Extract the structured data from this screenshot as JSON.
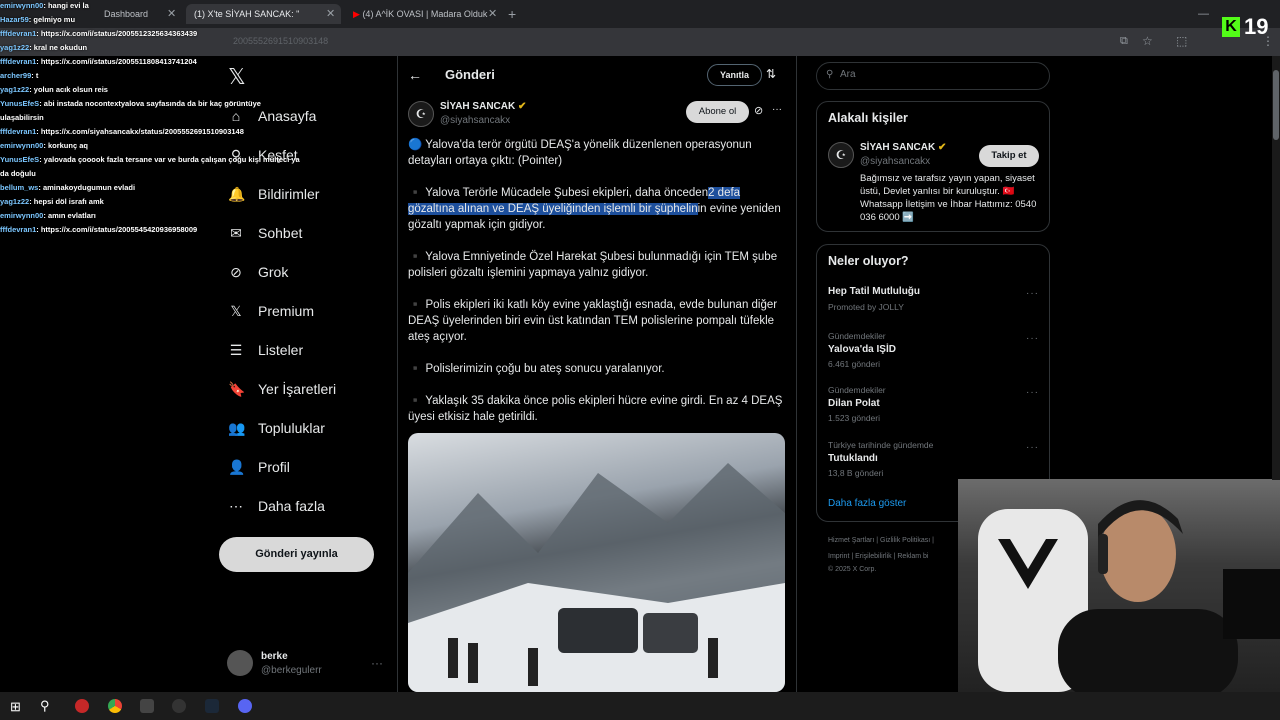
{
  "browser": {
    "tabs": [
      {
        "label": "Dashboard"
      },
      {
        "label": "(1) X'te SİYAH SANCAK: \"",
        "active": true
      },
      {
        "label": "(4) A^İK OVASI | Madara Olduk"
      }
    ],
    "url_fragment": "2005552691510903148"
  },
  "chat": {
    "messages": [
      {
        "user": "emirwynn00",
        "text": ": hangi evi la"
      },
      {
        "user": "Hazar59",
        "text": ": gelmiyo mu"
      },
      {
        "user": "fffdevran1",
        "text": ": https://x.com/i/status/2005512325634363439"
      },
      {
        "user": "yag1z22",
        "text": ": kral ne okudun"
      },
      {
        "user": "fffdevran1",
        "text": ": https://x.com/i/status/2005511808413741204"
      },
      {
        "user": "archer99",
        "text": ": t"
      },
      {
        "user": "yag1z22",
        "text": ": yolun acık olsun reis"
      },
      {
        "user": "YunusEfeS",
        "text": ": abi instada nocontextyalova sayfasında da bir kaç görüntüye"
      },
      {
        "user": "",
        "text": "ulaşabilirsin"
      },
      {
        "user": "fffdevran1",
        "text": ": https://x.com/siyahsancakx/status/2005552691510903148"
      },
      {
        "user": "emirwynn00",
        "text": ": korkunç aq"
      },
      {
        "user": "YunusEfeS",
        "text": ": yalovada çooook fazla tersane var ve burda çalışan çoğu kişi mülteci ya"
      },
      {
        "user": "",
        "text": "da doğulu"
      },
      {
        "user": "bellum_ws",
        "text": ": aminakoydugumun evladi"
      },
      {
        "user": "yag1z22",
        "text": ": hepsi döl israfı amk"
      },
      {
        "user": "emirwynn00",
        "text": ": amın evlatları"
      },
      {
        "user": "fffdevran1",
        "text": ": https://x.com/i/status/2005545420936958009"
      }
    ]
  },
  "kick_counter": "19",
  "sidebar": {
    "items": [
      {
        "label": "Anasayfa",
        "icon": "home-icon"
      },
      {
        "label": "Keşfet",
        "icon": "search-icon"
      },
      {
        "label": "Bildirimler",
        "icon": "bell-icon"
      },
      {
        "label": "Sohbet",
        "icon": "mail-icon"
      },
      {
        "label": "Grok",
        "icon": "grok-icon"
      },
      {
        "label": "Premium",
        "icon": "x-icon"
      },
      {
        "label": "Listeler",
        "icon": "list-icon"
      },
      {
        "label": "Yer İşaretleri",
        "icon": "bookmark-icon"
      },
      {
        "label": "Topluluklar",
        "icon": "people-icon"
      },
      {
        "label": "Profil",
        "icon": "user-icon"
      },
      {
        "label": "Daha fazla",
        "icon": "more-icon"
      }
    ],
    "publish": "Gönderi yayınla",
    "account": {
      "name": "berke",
      "handle": "@berkegulerr"
    }
  },
  "post": {
    "header": "Gönderi",
    "reply": "Yanıtla",
    "author": "SİYAH SANCAK",
    "handle": "@siyahsancakx",
    "subscribe": "Abone ol",
    "p1": "🔵 Yalova'da terör örgütü DEAŞ'a yönelik düzenlenen operasyonun detayları ortaya çıktı: (Pointer)",
    "p2a": "▪️ Yalova Terörle Mücadele Şubesi ekipleri, daha önceden",
    "p2b": "2 defa gözaltına alınan ve DEAŞ üyeliğinden işlemli bir şüphelin",
    "p2c": "in evine yeniden gözaltı yapmak için gidiyor.",
    "p3": "▪️ Yalova Emniyetinde Özel Harekat Şubesi bulunmadığı için TEM şube polisleri gözaltı işlemini yapmaya yalnız gidiyor.",
    "p4": "▪️ Polis ekipleri iki katlı köy evine yaklaştığı esnada, evde bulunan diğer DEAŞ üyelerinden biri evin üst katından TEM polislerine pompalı tüfekle ateş açıyor.",
    "p5": "▪️ Polislerimizin çoğu bu ateş sonucu yaralanıyor.",
    "p6": "▪️ Yaklaşık 35 dakika önce polis ekipleri hücre evine girdi. En az 4 DEAŞ üyesi etkisiz hale getirildi."
  },
  "right": {
    "search_placeholder": "Ara",
    "related_title": "Alakalı kişiler",
    "related_name": "SİYAH SANCAK",
    "related_handle": "@siyahsancakx",
    "follow": "Takip et",
    "bio": "Bağımsız ve tarafsız yayın yapan, siyaset üstü, Devlet yanlısı bir kuruluştur. 🇹🇷 Whatsapp İletişim ve İhbar Hattımız: 0540 036 6000 ➡️",
    "whats_title": "Neler oluyor?",
    "trends": [
      {
        "context": "",
        "title": "Hep Tatil Mutluluğu",
        "meta": "Promoted by JOLLY"
      },
      {
        "context": "Gündemdekiler",
        "title": "Yalova'da IŞİD",
        "meta": "6.461 gönderi"
      },
      {
        "context": "Gündemdekiler",
        "title": "Dilan Polat",
        "meta": "1.523 gönderi"
      },
      {
        "context": "Türkiye tarihinde gündemde",
        "title": "Tutuklandı",
        "meta": "13,8 B gönderi"
      }
    ],
    "show_more": "Daha fazla göster",
    "footer1": "Hizmet Şartları  |  Gizlilik Politikası  |",
    "footer2": "Imprint  |  Erişilebilirlik  |  Reklam bi",
    "footer3": "© 2025 X Corp."
  },
  "colors": {
    "accent": "#1d9bf0",
    "highlight": "#1d4f9c"
  }
}
